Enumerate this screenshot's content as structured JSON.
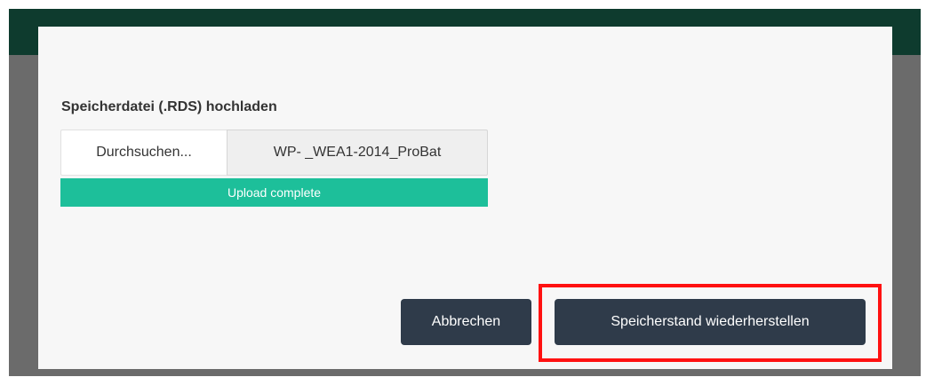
{
  "dialog": {
    "upload_label": "Speicherdatei (.RDS) hochladen",
    "browse_label": "Durchsuchen...",
    "file_name": "WP-  _WEA1-2014_ProBat",
    "progress_text": "Upload complete",
    "progress_fraction": 1.0,
    "cancel_label": "Abbrechen",
    "restore_label": "Speicherstand wiederherstellen"
  },
  "colors": {
    "topbar": "#0e3b2e",
    "backdrop": "#6b6b6b",
    "modal_bg": "#f7f7f7",
    "progress": "#1dbf9a",
    "button_bg": "#2f3b4a",
    "highlight": "#ff1111"
  }
}
